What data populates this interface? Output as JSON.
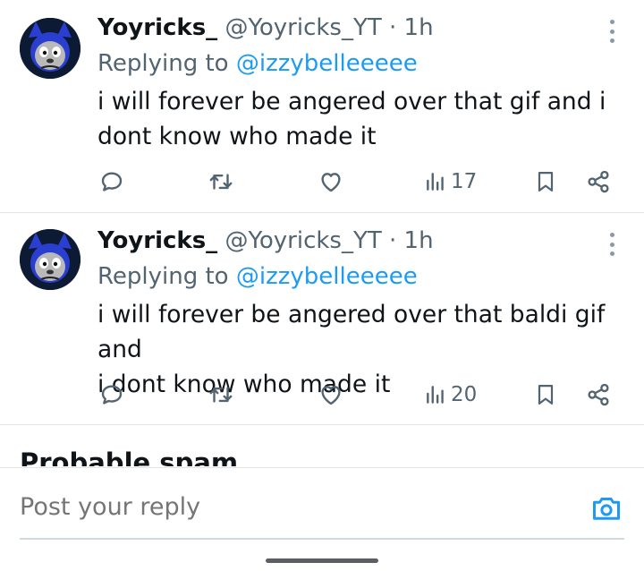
{
  "tweets": [
    {
      "name": "Yoyricks_",
      "handle": "@Yoyricks_YT",
      "dot": "·",
      "time": "1h",
      "replying_prefix": "Replying to ",
      "replying_to": "@izzybelleeeee",
      "text_line1": "i will forever be angered over that gif and i",
      "text_line2": "dont know who made it",
      "views": "17"
    },
    {
      "name": "Yoyricks_",
      "handle": "@Yoyricks_YT",
      "dot": "·",
      "time": "1h",
      "replying_prefix": "Replying to ",
      "replying_to": "@izzybelleeeee",
      "text_line1": "i will forever be angered over that baldi gif and",
      "text_line2": "i dont know who made it",
      "views": "20"
    }
  ],
  "section": {
    "label": "Probable spam"
  },
  "composer": {
    "placeholder": "Post your reply"
  },
  "colors": {
    "accent": "#1d9bf0",
    "secondary_text": "#536471",
    "icon": "#536471",
    "divider": "#dfe3e6"
  }
}
